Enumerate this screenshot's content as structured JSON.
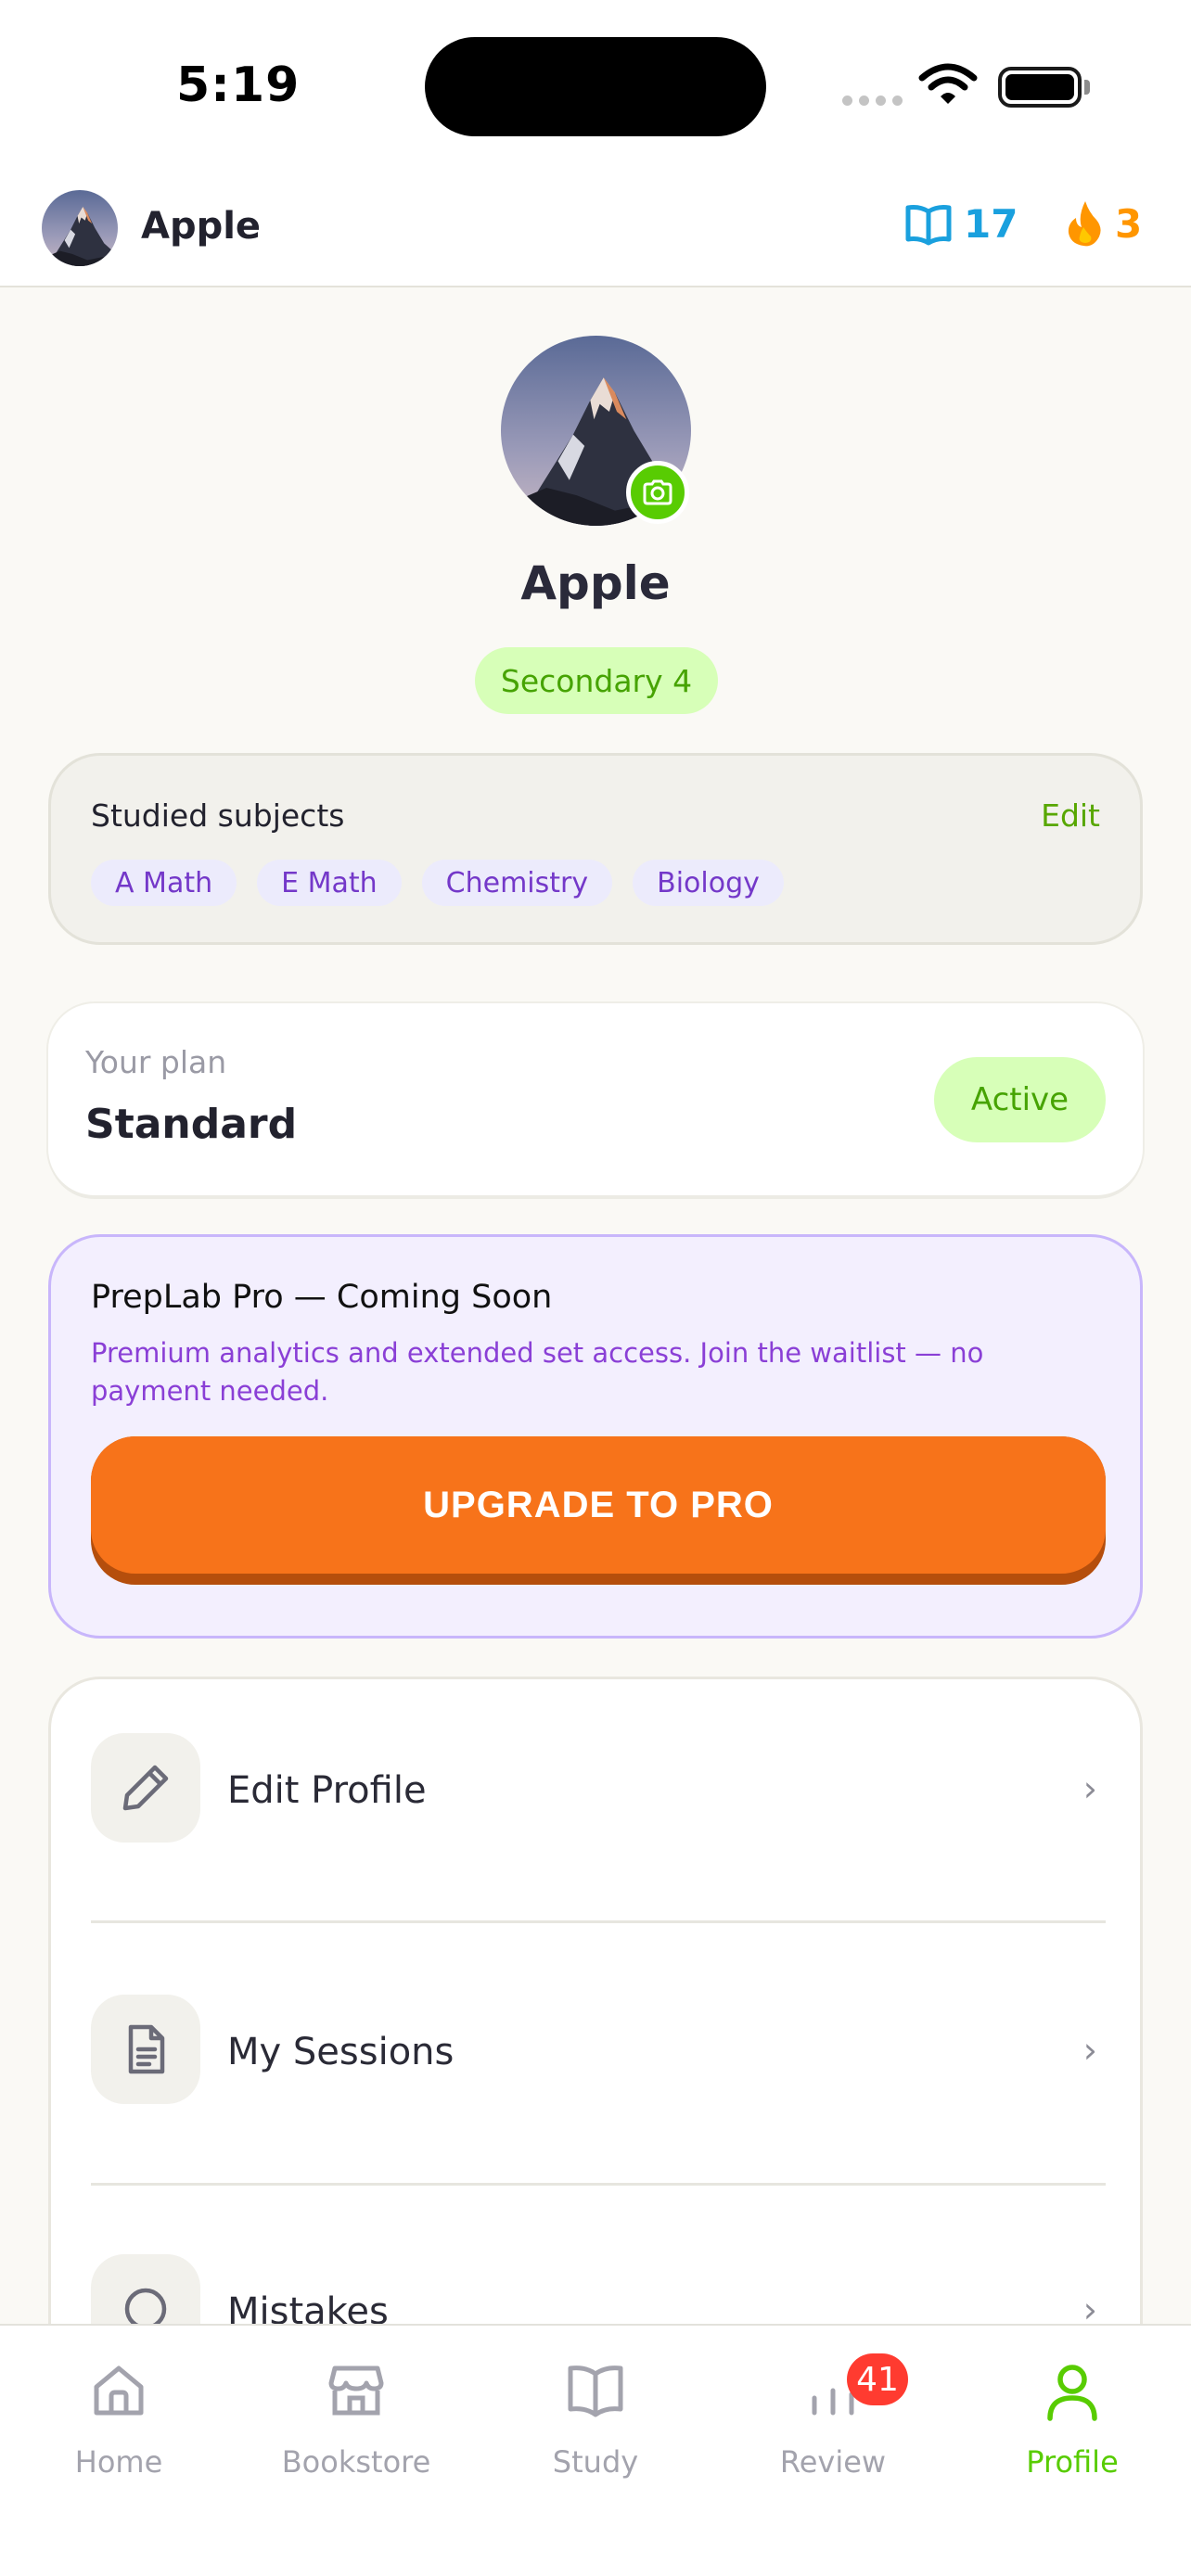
{
  "status_bar": {
    "time": "5:19"
  },
  "header": {
    "username": "Apple",
    "book_count": "17",
    "streak_count": "3"
  },
  "profile": {
    "name": "Apple",
    "grade": "Secondary 4"
  },
  "subjects": {
    "title": "Studied subjects",
    "edit_label": "Edit",
    "items": [
      "A Math",
      "E Math",
      "Chemistry",
      "Biology"
    ]
  },
  "plan": {
    "label": "Your plan",
    "name": "Standard",
    "status": "Active"
  },
  "pro": {
    "title": "PrepLab Pro — Coming Soon",
    "description": "Premium analytics and extended set access. Join the waitlist — no payment needed.",
    "button_label": "UPGRADE TO PRO"
  },
  "menu": {
    "items": [
      {
        "label": "Edit Profile",
        "icon": "pencil-icon"
      },
      {
        "label": "My Sessions",
        "icon": "document-icon"
      },
      {
        "label": "Mistakes",
        "icon": "search-icon"
      }
    ],
    "chevron": "›"
  },
  "tabs": {
    "items": [
      {
        "label": "Home",
        "icon": "home-icon"
      },
      {
        "label": "Bookstore",
        "icon": "store-icon"
      },
      {
        "label": "Study",
        "icon": "book-icon"
      },
      {
        "label": "Review",
        "icon": "bar-chart-icon",
        "badge": "41"
      },
      {
        "label": "Profile",
        "icon": "user-icon",
        "active": true
      }
    ]
  },
  "colors": {
    "accent_green": "#58cc02",
    "streak_orange": "#ff9600",
    "book_blue": "#1aa0de",
    "pro_button": "#f7731a",
    "badge_red": "#ff3b30"
  }
}
